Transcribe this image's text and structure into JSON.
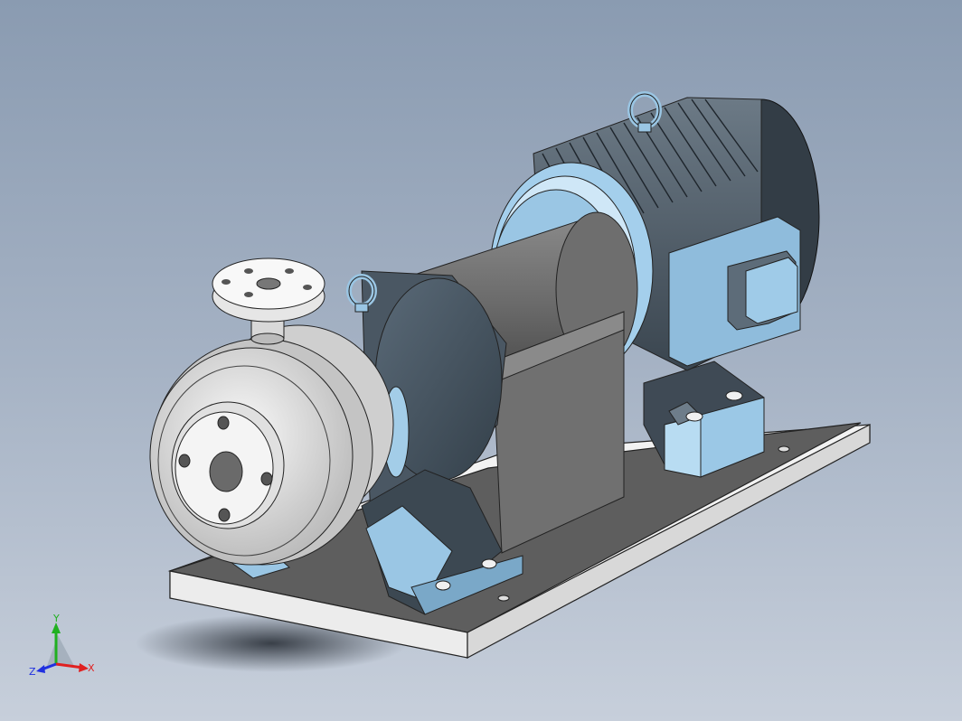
{
  "view": {
    "background_top": "#8a9bb1",
    "background_bottom": "#c7cfdb",
    "model_colors": {
      "stainless": "#d6d6d6",
      "casing_dark": "#4a5763",
      "motor_blue": "#a9d2ee",
      "base_plate": "#5c5c5c"
    }
  },
  "triad": {
    "x_label": "X",
    "y_label": "Y",
    "z_label": "Z",
    "x_color": "#e02020",
    "y_color": "#20b020",
    "z_color": "#2030e0"
  }
}
